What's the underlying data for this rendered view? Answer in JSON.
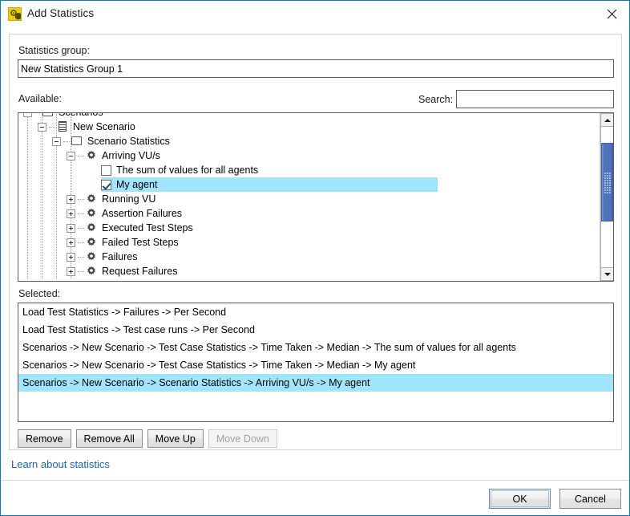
{
  "window": {
    "title": "Add Statistics",
    "icon": "app-statistics-icon",
    "close_icon": "close-icon"
  },
  "form": {
    "stats_group_label": "Statistics group:",
    "stats_group_value": "New Statistics Group 1",
    "stats_group_placeholder": "",
    "available_label": "Available:",
    "search_label": "Search:",
    "search_value": "",
    "search_placeholder": "",
    "selected_label": "Selected:"
  },
  "tree": {
    "nodes": [
      {
        "label": "Scenarios",
        "depth": 0,
        "icon": "monitor-icon",
        "expander": "minus",
        "checkbox": "none",
        "selected": false
      },
      {
        "label": "New Scenario",
        "depth": 1,
        "icon": "server-icon",
        "expander": "minus",
        "checkbox": "none",
        "selected": false
      },
      {
        "label": "Scenario Statistics",
        "depth": 2,
        "icon": "monitor-icon",
        "expander": "minus",
        "checkbox": "none",
        "selected": false
      },
      {
        "label": "Arriving VU/s",
        "depth": 3,
        "icon": "gear-icon",
        "expander": "minus",
        "checkbox": "none",
        "selected": false
      },
      {
        "label": "The sum of values for all agents",
        "depth": 4,
        "icon": "none",
        "expander": "none",
        "checkbox": "unchecked",
        "selected": false
      },
      {
        "label": "My agent",
        "depth": 4,
        "icon": "none",
        "expander": "none",
        "checkbox": "checked",
        "selected": true
      },
      {
        "label": "Running VU",
        "depth": 3,
        "icon": "gear-icon",
        "expander": "plus",
        "checkbox": "none",
        "selected": false
      },
      {
        "label": "Assertion Failures",
        "depth": 3,
        "icon": "gear-icon",
        "expander": "plus",
        "checkbox": "none",
        "selected": false
      },
      {
        "label": "Executed Test Steps",
        "depth": 3,
        "icon": "gear-icon",
        "expander": "plus",
        "checkbox": "none",
        "selected": false
      },
      {
        "label": "Failed Test Steps",
        "depth": 3,
        "icon": "gear-icon",
        "expander": "plus",
        "checkbox": "none",
        "selected": false
      },
      {
        "label": "Failures",
        "depth": 3,
        "icon": "gear-icon",
        "expander": "plus",
        "checkbox": "none",
        "selected": false
      },
      {
        "label": "Request Failures",
        "depth": 3,
        "icon": "gear-icon",
        "expander": "plus",
        "checkbox": "none",
        "selected": false
      }
    ],
    "scrollbar": {
      "up_icon": "scroll-up-arrow-icon",
      "down_icon": "scroll-down-arrow-icon"
    }
  },
  "selected_list": {
    "items": [
      {
        "label": "Load Test Statistics -> Failures -> Per Second",
        "selected": false
      },
      {
        "label": "Load Test Statistics -> Test case runs -> Per Second",
        "selected": false
      },
      {
        "label": "Scenarios -> New Scenario -> Test Case Statistics -> Time Taken -> Median -> The sum of values for all agents",
        "selected": false
      },
      {
        "label": "Scenarios -> New Scenario -> Test Case Statistics -> Time Taken -> Median -> My agent",
        "selected": false
      },
      {
        "label": "Scenarios -> New Scenario -> Scenario Statistics -> Arriving VU/s -> My agent",
        "selected": true
      }
    ]
  },
  "actions": {
    "remove": "Remove",
    "remove_all": "Remove All",
    "move_up": "Move Up",
    "move_down": "Move Down",
    "move_down_disabled": true
  },
  "learn_link": "Learn about statistics",
  "footer": {
    "ok": "OK",
    "cancel": "Cancel"
  },
  "colors": {
    "accent": "#0078d7",
    "selection": "#9fe5fb",
    "link": "#1464b4",
    "scrollbar_thumb": "#4f74bd",
    "icon_yellow": "#f2cb00"
  }
}
